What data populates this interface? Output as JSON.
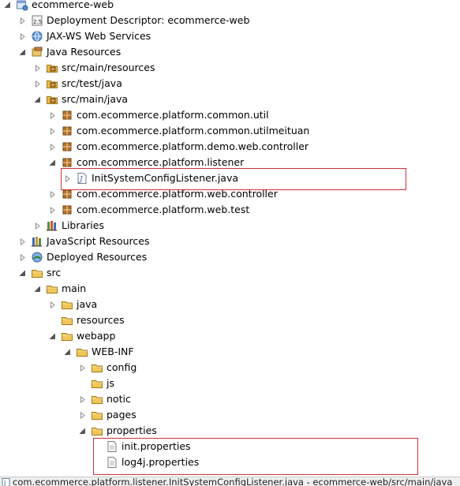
{
  "project_explorer": {
    "items": [
      {
        "label": "ecommerce-web",
        "depth": 0,
        "arrow": "expanded",
        "icon": "web-project-icon",
        "name": "tree-item-ecommerce-web"
      },
      {
        "label": "Deployment Descriptor: ecommerce-web",
        "depth": 1,
        "arrow": "collapsed",
        "icon": "deployment-descriptor-icon",
        "name": "tree-item-deployment-descriptor"
      },
      {
        "label": "JAX-WS Web Services",
        "depth": 1,
        "arrow": "collapsed",
        "icon": "web-services-icon",
        "name": "tree-item-jax-ws"
      },
      {
        "label": "Java Resources",
        "depth": 1,
        "arrow": "expanded",
        "icon": "java-resources-icon",
        "name": "tree-item-java-resources"
      },
      {
        "label": "src/main/resources",
        "depth": 2,
        "arrow": "collapsed",
        "icon": "source-folder-icon",
        "name": "tree-item-src-main-resources"
      },
      {
        "label": "src/test/java",
        "depth": 2,
        "arrow": "collapsed",
        "icon": "source-folder-icon",
        "name": "tree-item-src-test-java"
      },
      {
        "label": "src/main/java",
        "depth": 2,
        "arrow": "expanded",
        "icon": "source-folder-icon",
        "name": "tree-item-src-main-java"
      },
      {
        "label": "com.ecommerce.platform.common.util",
        "depth": 3,
        "arrow": "collapsed",
        "icon": "package-icon",
        "name": "tree-item-pkg-common-util"
      },
      {
        "label": "com.ecommerce.platform.common.utilmeituan",
        "depth": 3,
        "arrow": "collapsed",
        "icon": "package-icon",
        "name": "tree-item-pkg-common-utilmeituan"
      },
      {
        "label": "com.ecommerce.platform.demo.web.controller",
        "depth": 3,
        "arrow": "collapsed",
        "icon": "package-icon",
        "name": "tree-item-pkg-demo-web-controller"
      },
      {
        "label": "com.ecommerce.platform.listener",
        "depth": 3,
        "arrow": "expanded",
        "icon": "package-icon",
        "name": "tree-item-pkg-listener"
      },
      {
        "label": "InitSystemConfigListener.java",
        "depth": 4,
        "arrow": "collapsed",
        "icon": "java-file-icon",
        "name": "tree-item-init-system-config-listener"
      },
      {
        "label": "com.ecommerce.platform.web.controller",
        "depth": 3,
        "arrow": "collapsed",
        "icon": "package-icon",
        "name": "tree-item-pkg-web-controller"
      },
      {
        "label": "com.ecommerce.platform.web.test",
        "depth": 3,
        "arrow": "collapsed",
        "icon": "package-icon",
        "name": "tree-item-pkg-web-test"
      },
      {
        "label": "Libraries",
        "depth": 2,
        "arrow": "collapsed",
        "icon": "libraries-icon",
        "name": "tree-item-libraries"
      },
      {
        "label": "JavaScript Resources",
        "depth": 1,
        "arrow": "collapsed",
        "icon": "javascript-resources-icon",
        "name": "tree-item-javascript-resources"
      },
      {
        "label": "Deployed Resources",
        "depth": 1,
        "arrow": "collapsed",
        "icon": "deployed-resources-icon",
        "name": "tree-item-deployed-resources"
      },
      {
        "label": "src",
        "depth": 1,
        "arrow": "expanded",
        "icon": "folder-icon",
        "name": "tree-item-src"
      },
      {
        "label": "main",
        "depth": 2,
        "arrow": "expanded",
        "icon": "folder-icon",
        "name": "tree-item-main"
      },
      {
        "label": "java",
        "depth": 3,
        "arrow": "collapsed",
        "icon": "folder-icon",
        "name": "tree-item-java"
      },
      {
        "label": "resources",
        "depth": 3,
        "arrow": "none",
        "icon": "folder-icon",
        "name": "tree-item-resources"
      },
      {
        "label": "webapp",
        "depth": 3,
        "arrow": "expanded",
        "icon": "folder-icon",
        "name": "tree-item-webapp"
      },
      {
        "label": "WEB-INF",
        "depth": 4,
        "arrow": "expanded",
        "icon": "folder-icon",
        "name": "tree-item-web-inf"
      },
      {
        "label": "config",
        "depth": 5,
        "arrow": "collapsed",
        "icon": "folder-icon",
        "name": "tree-item-config"
      },
      {
        "label": "js",
        "depth": 5,
        "arrow": "none",
        "icon": "folder-icon",
        "name": "tree-item-js"
      },
      {
        "label": "notic",
        "depth": 5,
        "arrow": "collapsed",
        "icon": "folder-icon",
        "name": "tree-item-notic"
      },
      {
        "label": "pages",
        "depth": 5,
        "arrow": "collapsed",
        "icon": "folder-icon",
        "name": "tree-item-pages"
      },
      {
        "label": "properties",
        "depth": 5,
        "arrow": "expanded",
        "icon": "folder-icon",
        "name": "tree-item-properties"
      },
      {
        "label": "init.properties",
        "depth": 6,
        "arrow": "none",
        "icon": "file-icon",
        "name": "tree-item-init-properties"
      },
      {
        "label": "log4j.properties",
        "depth": 6,
        "arrow": "none",
        "icon": "file-icon",
        "name": "tree-item-log4j-properties"
      }
    ]
  },
  "status_bar": {
    "text": "com.ecommerce.platform.listener.InitSystemConfigListener.java - ecommerce-web/src/main/java"
  },
  "colors": {
    "highlight_border": "#d22f3a",
    "folder": "#e8b949",
    "package": "#b5722a"
  }
}
